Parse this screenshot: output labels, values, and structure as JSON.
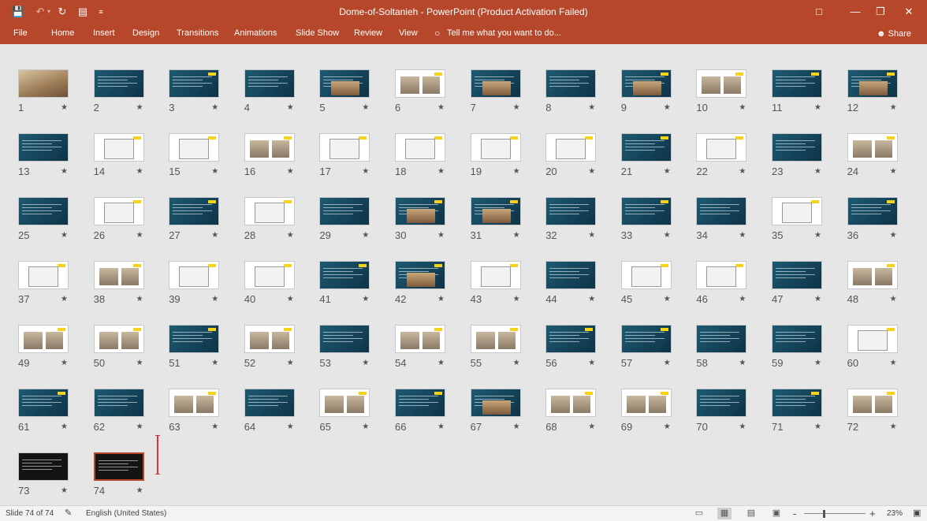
{
  "window": {
    "title": "Dome-of-Soltanieh - PowerPoint (Product Activation Failed)",
    "qat_icons": [
      "save-icon",
      "undo-icon",
      "redo-icon",
      "start-from-beginning-icon",
      "customize-qat-icon"
    ],
    "controls": [
      "ribbon-display-options-icon",
      "minimize-icon",
      "restore-icon",
      "close-icon"
    ]
  },
  "ribbon": {
    "tabs": [
      "File",
      "Home",
      "Insert",
      "Design",
      "Transitions",
      "Animations",
      "Slide Show",
      "Review",
      "View"
    ],
    "tell_me": "Tell me what you want to do...",
    "share": "Share"
  },
  "sorter": {
    "star": "★",
    "selected": 74,
    "slides": [
      "1",
      "2",
      "3",
      "4",
      "5",
      "6",
      "7",
      "8",
      "9",
      "10",
      "11",
      "12",
      "13",
      "14",
      "15",
      "16",
      "17",
      "18",
      "19",
      "20",
      "21",
      "22",
      "23",
      "24",
      "25",
      "26",
      "27",
      "28",
      "29",
      "30",
      "31",
      "32",
      "33",
      "34",
      "35",
      "36",
      "37",
      "38",
      "39",
      "40",
      "41",
      "42",
      "43",
      "44",
      "45",
      "46",
      "47",
      "48",
      "49",
      "50",
      "51",
      "52",
      "53",
      "54",
      "55",
      "56",
      "57",
      "58",
      "59",
      "60",
      "61",
      "62",
      "63",
      "64",
      "65",
      "66",
      "67",
      "68",
      "69",
      "70",
      "71",
      "72",
      "73",
      "74"
    ]
  },
  "status": {
    "slide_info": "Slide 74 of 74",
    "language": "English (United States)",
    "zoom": "23%",
    "view_icons": [
      "normal-view-icon",
      "slide-sorter-view-icon",
      "reading-view-icon",
      "slide-show-icon"
    ],
    "zoom_out": "-",
    "zoom_in": "+"
  },
  "colors": {
    "accent": "#b7472a",
    "slide_theme": "#1f4e66",
    "highlight": "#f6d21b"
  }
}
